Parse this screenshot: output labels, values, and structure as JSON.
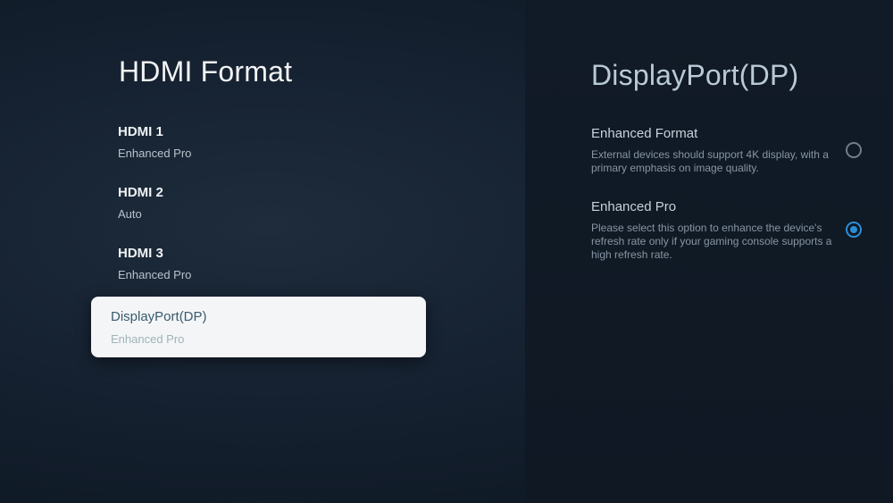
{
  "menu": {
    "title": "HDMI Format",
    "items": [
      {
        "label": "HDMI 1",
        "value": "Enhanced Pro"
      },
      {
        "label": "HDMI 2",
        "value": "Auto"
      },
      {
        "label": "HDMI 3",
        "value": "Enhanced Pro"
      },
      {
        "label": "DisplayPort(DP)",
        "value": "Enhanced Pro",
        "selected": true
      }
    ]
  },
  "detail": {
    "title": "DisplayPort(DP)",
    "options": [
      {
        "title": "Enhanced Format",
        "description": "External devices should support 4K display, with a primary emphasis on image quality.",
        "checked": false
      },
      {
        "title": "Enhanced Pro",
        "description": "Please select this option to enhance the device's refresh rate only if your gaming console supports a high refresh rate.",
        "checked": true
      }
    ]
  },
  "colors": {
    "accent": "#2a8fd6",
    "selected_bg": "#f3f5f7"
  },
  "icons": {
    "radio_unchecked": "radio-unchecked-icon",
    "radio_checked": "radio-checked-icon"
  }
}
